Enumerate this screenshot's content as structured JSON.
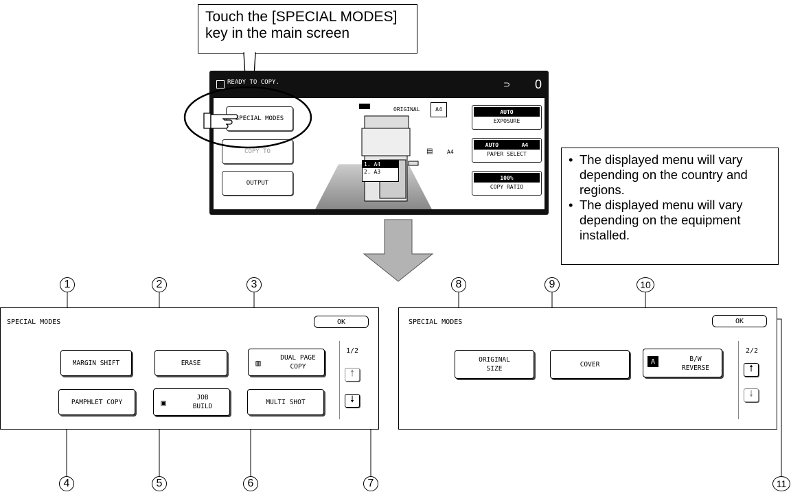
{
  "callout": {
    "line1": "Touch the [SPECIAL MODES]",
    "line2": "key in the main screen"
  },
  "main_screen": {
    "status_text": "READY TO COPY.",
    "copy_count": "0",
    "keys": {
      "special_modes": "SPECIAL MODES",
      "hidden_key": "COPY TO",
      "output": "OUTPUT"
    },
    "original_label": "ORIGINAL",
    "original_size": "A4",
    "paper_size_label": "A4",
    "tray_list": [
      "1. A4",
      "2. A3"
    ],
    "exposure": {
      "value": "AUTO",
      "label": "EXPOSURE"
    },
    "paper_select": {
      "value_left": "AUTO",
      "value_right": "A4",
      "label": "PAPER SELECT"
    },
    "copy_ratio": {
      "value": "100%",
      "label": "COPY RATIO"
    }
  },
  "info_box": {
    "bullets": [
      "The displayed menu will vary depending on the country and regions.",
      "The displayed menu will vary depending on the equipment installed."
    ]
  },
  "panel_left": {
    "title": "SPECIAL MODES",
    "ok_label": "OK",
    "page_indicator": "1/2",
    "buttons": {
      "margin_shift": "MARGIN SHIFT",
      "erase": "ERASE",
      "dual_page_copy_l1": "DUAL PAGE",
      "dual_page_copy_l2": "COPY",
      "pamphlet_copy": "PAMPHLET COPY",
      "job_build_l1": "JOB",
      "job_build_l2": "BUILD",
      "multi_shot": "MULTI SHOT"
    }
  },
  "panel_right": {
    "title": "SPECIAL MODES",
    "ok_label": "OK",
    "page_indicator": "2/2",
    "buttons": {
      "original_size_l1": "ORIGINAL",
      "original_size_l2": "SIZE",
      "cover": "COVER",
      "bw_reverse_l1": "B/W",
      "bw_reverse_l2": "REVERSE"
    }
  },
  "callout_numbers": [
    "1",
    "2",
    "3",
    "4",
    "5",
    "6",
    "7",
    "8",
    "9",
    "10",
    "11"
  ],
  "icons": [
    "pointing-hand-icon",
    "copier-icon",
    "arrow-down-icon",
    "arrow-up-icon",
    "dual-page-icon",
    "job-build-icon",
    "bw-reverse-icon"
  ]
}
